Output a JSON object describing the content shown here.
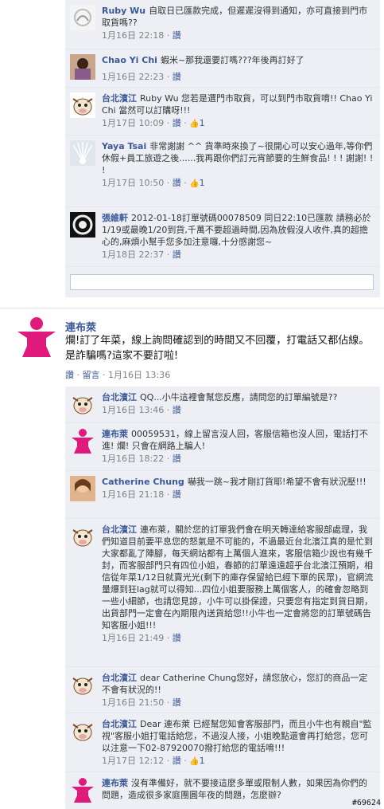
{
  "top_comments": [
    {
      "name": "Ruby Wu",
      "text": "自取日已匯款完成，但遲遲沒得到通知，亦可直接到門市取貨嗎??",
      "time": "1月16日 22:18",
      "like_label": "讚",
      "likes": ""
    },
    {
      "name": "Chao Yi Chi",
      "text": "蝦米~那我還要訂嗎???年後再訂好了",
      "time": "1月16日 22:23",
      "like_label": "讚",
      "likes": ""
    },
    {
      "name": "台北濱江",
      "text": "Ruby Wu 您若是選門市取貨，可以到門市取貨唷!! Chao Yi Chi 當然可以訂購呀!!!",
      "time": "1月17日 10:09",
      "like_label": "讚",
      "likes": "1"
    },
    {
      "name": "Yaya Tsai",
      "text": "非常謝謝 ^^ 貨準時來換了~很開心可以安心過年,等你們休假+員工旅遊之後......我再跟你們訂元宵節要的生鮮食品! ! ! 謝謝! ! !",
      "time": "1月17日 10:50",
      "like_label": "讚",
      "likes": "1"
    },
    {
      "name": "張維軒",
      "text": "2012-01-18訂單號碼00078509 同日22:10已匯款 請務必於1/19或最晚1/20到貨,千萬不要超過時間,因為放假沒人收件,真的超擔心的,麻煩小幫手您多加注意囉,十分感謝您~",
      "time": "1月18日 22:37",
      "like_label": "讚",
      "likes": ""
    }
  ],
  "post": {
    "author": "連布萊",
    "text": "爛!訂了年菜，線上詢問確認到的時間又不回覆，打電話又都佔線。是詐騙嗎?這家不要訂啦!",
    "like_label": "讚",
    "comment_label": "留言",
    "time": "1月16日 13:36"
  },
  "replies": [
    {
      "name": "台北濱江",
      "text": "QQ...小牛這裡會幫您反應，請問您的訂單編號是??",
      "time": "1月16日 13:46",
      "like_label": "讚",
      "likes": ""
    },
    {
      "name": "連布萊",
      "text": "00059531，線上留言沒人回，客服信箱也沒人回，電話打不進! 爛! 只會在網路上騙人!",
      "time": "1月16日 18:22",
      "like_label": "讚",
      "likes": ""
    },
    {
      "name": "Catherine Chung",
      "text": "嚇我一跳~我才剛訂貨耶!希望不會有狀況壓!!!",
      "time": "1月16日 21:18",
      "like_label": "讚",
      "likes": ""
    },
    {
      "name": "台北濱江",
      "text": "連布萊，關於您的訂單我們會在明天轉達給客服部處理，我們知道目前要平息您的怒氣是不可能的，不過最近台北濱江真的是忙到大家都亂了陣腳，每天網站都有上萬個人進來，客服信箱少說也有幾千封，而客服部門只有四位小姐，春節的訂單遠遠超乎台北濱江預期，相信從年菜1/12日就賣光光(剩下的庫存保留給已經下單的民眾)，官網流量爆到狂lag就可以得知...四位小姐要服務上萬個客人，的確會忽略到一些小細節，也請您見諒，小牛可以掛保證，只要您有指定到貨日期，出貨部門一定會在內期限內送貨給您!!小牛也一定會將您的訂單號碼告知客服小姐!!!",
      "time": "1月16日 21:49",
      "like_label": "讚",
      "likes": ""
    },
    {
      "name": "台北濱江",
      "text": "dear Catherine Chung您好，請您放心，您訂的商品一定不會有狀況的!!",
      "time": "1月16日 21:50",
      "like_label": "讚",
      "likes": ""
    },
    {
      "name": "台北濱江",
      "text": "Dear 連布萊 已經幫您知會客服部門，而且小牛也有親自\"監視\"客服小姐打電話給您，不過沒人接，小姐晚點還會再打給您，您可以注意一下02-87920070撥打給您的電話唷!!!",
      "time": "1月17日 12:12",
      "like_label": "讚",
      "likes": "1"
    },
    {
      "name": "連布萊",
      "text": "沒有準備好，就不要接這麼多單或限制人數，如果因為你們的問題，造成很多家庭團圓年夜的問題，怎麼辦?",
      "time": "",
      "like_label": "",
      "likes": ""
    }
  ],
  "watermark": "#69624",
  "colors": {
    "link": "#3b5998",
    "comment_bg": "#edeff4",
    "pink_avatar": "#e0197d"
  }
}
